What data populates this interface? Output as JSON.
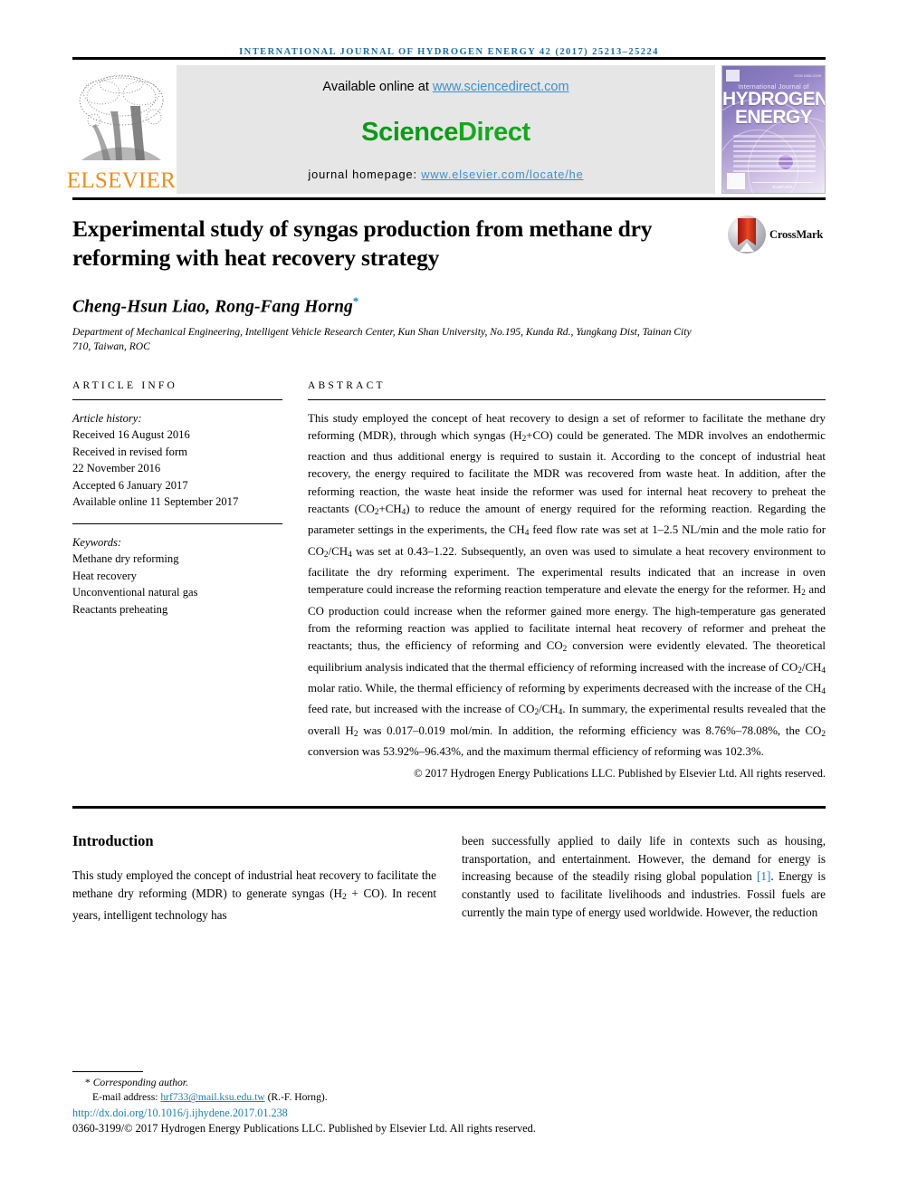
{
  "running_head": "International Journal of Hydrogen Energy 42 (2017) 25213–25224",
  "masthead": {
    "publisher_name": "ELSEVIER",
    "available_prefix": "Available online at ",
    "available_link": "www.sciencedirect.com",
    "sciencedirect_part1": "Science",
    "sciencedirect_part2": "Direct",
    "homepage_prefix": "journal homepage: ",
    "homepage_link": "www.elsevier.com/locate/he",
    "cover": {
      "kicker": "International Journal of",
      "title_line1": "HYDROGEN",
      "title_line2": "ENERGY",
      "issn_text": "ISSN 0360-3199",
      "publisher_small": "ELSEVIER"
    },
    "colors": {
      "link_blue": "#3b8fd0",
      "sciencedirect_green": "#0b9b17",
      "elsevier_orange": "#F08C1C",
      "banner_gray": "#e6e6e6"
    }
  },
  "title": "Experimental study of syngas production from methane dry reforming with heat recovery strategy",
  "crossmark_label": "CrossMark",
  "authors": "Cheng-Hsun Liao, Rong-Fang Horng",
  "author_marker": "*",
  "affiliation": "Department of Mechanical Engineering, Intelligent Vehicle Research Center, Kun Shan University, No.195, Kunda Rd., Yungkang Dist, Tainan City 710, Taiwan, ROC",
  "article_info": {
    "label": "ARTICLE INFO",
    "history_heading": "Article history:",
    "history": [
      "Received 16 August 2016",
      "Received in revised form",
      "22 November 2016",
      "Accepted 6 January 2017",
      "Available online 11 September 2017"
    ],
    "keywords_heading": "Keywords:",
    "keywords": [
      "Methane dry reforming",
      "Heat recovery",
      "Unconventional natural gas",
      "Reactants preheating"
    ]
  },
  "abstract": {
    "label": "ABSTRACT",
    "paragraph_html": "This study employed the concept of heat recovery to design a set of reformer to facilitate the methane dry reforming (MDR), through which syngas (H<sub>2</sub>+CO) could be generated. The MDR involves an endothermic reaction and thus additional energy is required to sustain it. According to the concept of industrial heat recovery, the energy required to facilitate the MDR was recovered from waste heat. In addition, after the reforming reaction, the waste heat inside the reformer was used for internal heat recovery to preheat the reactants (CO<sub>2</sub>+CH<sub>4</sub>) to reduce the amount of energy required for the reforming reaction. Regarding the parameter settings in the experiments, the CH<sub>4</sub> feed flow rate was set at 1–2.5 NL/min and the mole ratio for CO<sub>2</sub>/CH<sub>4</sub> was set at 0.43–1.22. Subsequently, an oven was used to simulate a heat recovery environment to facilitate the dry reforming experiment. The experimental results indicated that an increase in oven temperature could increase the reforming reaction temperature and elevate the energy for the reformer. H<sub>2</sub> and CO production could increase when the reformer gained more energy. The high-temperature gas generated from the reforming reaction was applied to facilitate internal heat recovery of reformer and preheat the reactants; thus, the efficiency of reforming and CO<sub>2</sub> conversion were evidently elevated. The theoretical equilibrium analysis indicated that the thermal efficiency of reforming increased with the increase of CO<sub>2</sub>/CH<sub>4</sub> molar ratio. While, the thermal efficiency of reforming by experiments decreased with the increase of the CH<sub>4</sub> feed rate, but increased with the increase of CO<sub>2</sub>/CH<sub>4</sub>. In summary, the experimental results revealed that the overall H<sub>2</sub> was 0.017–0.019 mol/min. In addition, the reforming efficiency was 8.76%–78.08%, the CO<sub>2</sub> conversion was 53.92%–96.43%, and the maximum thermal efficiency of reforming was 102.3%.",
    "copyright": "© 2017 Hydrogen Energy Publications LLC. Published by Elsevier Ltd. All rights reserved."
  },
  "introduction": {
    "heading": "Introduction",
    "left_html": "This study employed the concept of industrial heat recovery to facilitate the methane dry reforming (MDR) to generate syngas (H<sub>2</sub> + CO). In recent years, intelligent technology has",
    "right_html": "been successfully applied to daily life in contexts such as housing, transportation, and entertainment. However, the demand for energy is increasing because of the steadily rising global population <span class=\"cite\">[1]</span>. Energy is constantly used to facilitate livelihoods and industries. Fossil fuels are currently the main type of energy used worldwide. However, the reduction"
  },
  "footnotes": {
    "corresponding": "Corresponding author.",
    "corresponding_marker": "*",
    "email_label": "E-mail address: ",
    "email_address": "hrf733@mail.ksu.edu.tw",
    "email_suffix": " (R.-F. Horng).",
    "doi": "http://dx.doi.org/10.1016/j.ijhydene.2017.01.238",
    "issn_line": "0360-3199/© 2017 Hydrogen Energy Publications LLC. Published by Elsevier Ltd. All rights reserved."
  }
}
